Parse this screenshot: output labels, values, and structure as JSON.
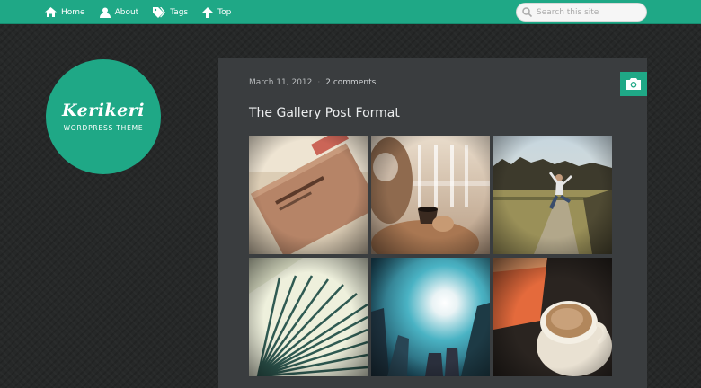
{
  "nav": [
    {
      "label": "Home",
      "icon": "home-icon"
    },
    {
      "label": "About",
      "icon": "user-icon"
    },
    {
      "label": "Tags",
      "icon": "tag-icon"
    },
    {
      "label": "Top",
      "icon": "arrow-up-icon"
    }
  ],
  "search": {
    "placeholder": "Search this site",
    "icon": "search-icon"
  },
  "site": {
    "title": "Kerikeri",
    "subtitle": "WORDPRESS THEME"
  },
  "post": {
    "date": "March 11, 2012",
    "separator": "·",
    "comments": "2 comments",
    "title": "The Gallery Post Format",
    "format_icon": "camera-icon"
  },
  "gallery": {
    "images": [
      "magazine-photo",
      "man-with-coffee-cup-photo",
      "person-jumping-on-path-photo",
      "folded-paper-fan-photo",
      "sun-through-buildings-photo",
      "coffee-cup-photo"
    ]
  },
  "colors": {
    "accent": "#1fa886",
    "background": "#262828",
    "panel": "#3a3d3f"
  }
}
